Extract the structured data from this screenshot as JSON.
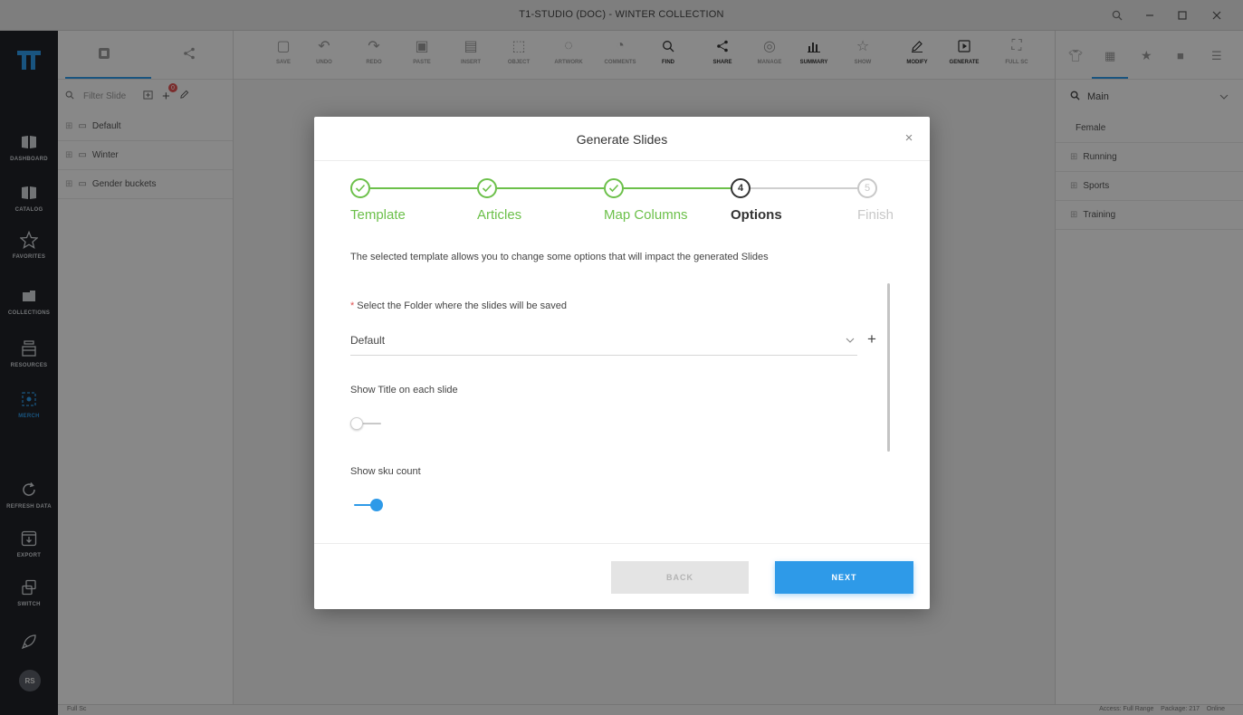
{
  "window": {
    "title": "T1-STUDIO (DOC) - WINTER COLLECTION"
  },
  "leftnav": {
    "items": [
      {
        "label": "DASHBOARD"
      },
      {
        "label": "CATALOG"
      },
      {
        "label": "FAVORITES"
      },
      {
        "label": "COLLECTIONS"
      },
      {
        "label": "RESOURCES"
      },
      {
        "label": "MERCH"
      },
      {
        "label": "REFRESH DATA"
      },
      {
        "label": "EXPORT"
      },
      {
        "label": "SWITCH"
      }
    ],
    "avatar_initials": "RS"
  },
  "tree": {
    "search_placeholder": "Filter Slide",
    "badge": "0",
    "rows": [
      {
        "label": "Default"
      },
      {
        "label": "Winter"
      },
      {
        "label": "Gender buckets"
      }
    ]
  },
  "toolbar": {
    "items": [
      {
        "label": "SAVE"
      },
      {
        "label": "UNDO"
      },
      {
        "label": "REDO"
      },
      {
        "label": "PASTE"
      },
      {
        "label": "INSERT"
      },
      {
        "label": "OBJECT"
      },
      {
        "label": "ARTWORK"
      },
      {
        "label": "COMMENTS"
      },
      {
        "label": "FIND"
      },
      {
        "label": "SHARE"
      },
      {
        "label": "MANAGE"
      },
      {
        "label": "SUMMARY"
      },
      {
        "label": "SHOW"
      },
      {
        "label": "MODIFY"
      },
      {
        "label": "GENERATE"
      },
      {
        "label": "FULL SC"
      }
    ]
  },
  "rightpane": {
    "search_label": "Main",
    "rows": [
      {
        "label": "Female"
      },
      {
        "label": "Running"
      },
      {
        "label": "Sports"
      },
      {
        "label": "Training"
      }
    ]
  },
  "statusbar": {
    "left": "Full Sc",
    "right": "Access: Full Range    Package: 217    Online"
  },
  "modal": {
    "title": "Generate Slides",
    "close_symbol": "×",
    "steps": [
      {
        "number": "1",
        "label": "Template",
        "state": "done"
      },
      {
        "number": "2",
        "label": "Articles",
        "state": "done"
      },
      {
        "number": "3",
        "label": "Map Columns",
        "state": "done"
      },
      {
        "number": "4",
        "label": "Options",
        "state": "current"
      },
      {
        "number": "5",
        "label": "Finish",
        "state": "pending"
      }
    ],
    "description": "The selected template allows you to change some options that will impact the generated Slides",
    "folder": {
      "required_mark": "*",
      "label": "Select the Folder where the slides will be saved",
      "value": "Default",
      "add_symbol": "+"
    },
    "show_title": {
      "label": "Show Title on each slide",
      "enabled": false
    },
    "show_sku": {
      "label": "Show sku count",
      "enabled": true
    },
    "buttons": {
      "back": "BACK",
      "next": "NEXT"
    }
  },
  "colors": {
    "accent": "#2e9ae8",
    "step_done": "#6cc04a",
    "step_current": "#333333",
    "step_pending": "#c8c8c8",
    "sidebar_bg": "#202227"
  }
}
